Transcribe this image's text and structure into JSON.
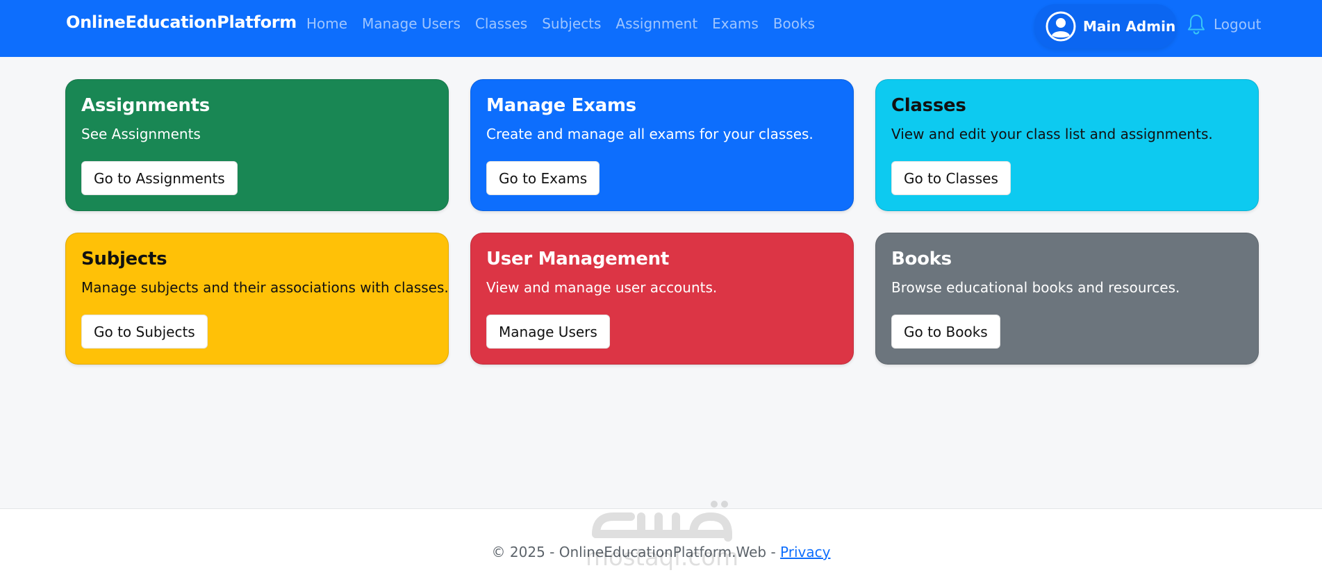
{
  "navbar": {
    "brand": "OnlineEducationPlatform",
    "links": [
      "Home",
      "Manage Users",
      "Classes",
      "Subjects",
      "Assignment",
      "Exams",
      "Books"
    ],
    "user_name": "Main Admin",
    "user_icon": "user-circle-icon",
    "logout_label": "Logout",
    "logout_icon": "bell-icon"
  },
  "cards": [
    {
      "title": "Assignments",
      "text": "See Assignments",
      "button": "Go to Assignments",
      "color": "#198754"
    },
    {
      "title": "Manage Exams",
      "text": "Create and manage all exams for your classes.",
      "button": "Go to Exams",
      "color": "#0d6efd"
    },
    {
      "title": "Classes",
      "text": "View and edit your class list and assignments.",
      "button": "Go to Classes",
      "color": "#0dcaf0"
    },
    {
      "title": "Subjects",
      "text": "Manage subjects and their associations with classes.",
      "button": "Go to Subjects",
      "color": "#ffc107"
    },
    {
      "title": "User Management",
      "text": "View and manage user accounts.",
      "button": "Manage Users",
      "color": "#dc3545"
    },
    {
      "title": "Books",
      "text": "Browse educational books and resources.",
      "button": "Go to Books",
      "color": "#6c757d"
    }
  ],
  "footer": {
    "text": "© 2025 - OnlineEducationPlatform.Web - ",
    "link": "Privacy"
  },
  "colors": {
    "navbar_bg": "#0d6efd",
    "page_bg": "#f6f7f9"
  }
}
